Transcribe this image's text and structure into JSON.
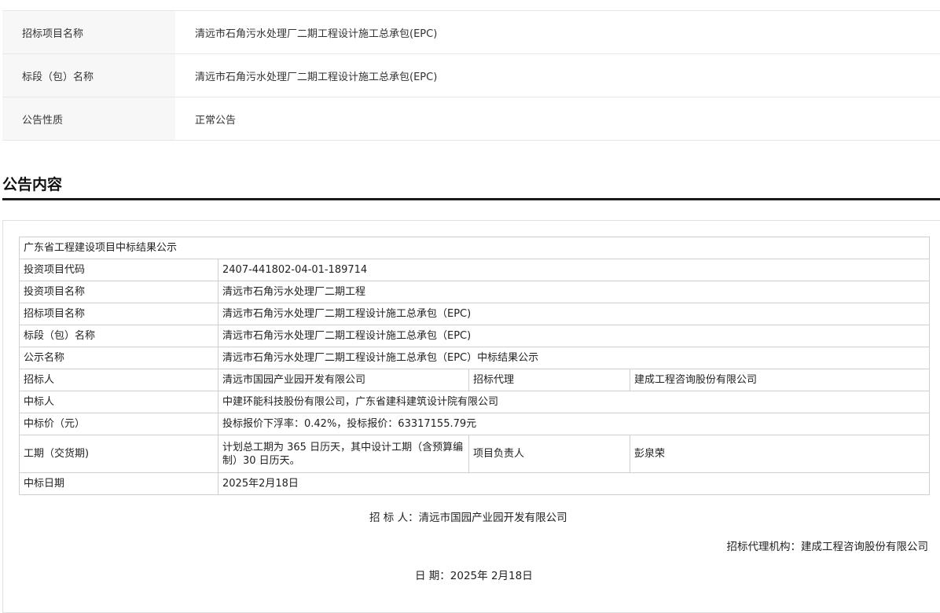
{
  "summary": {
    "rows": [
      {
        "label": "招标项目名称",
        "value": "清远市石角污水处理厂二期工程设计施工总承包(EPC)"
      },
      {
        "label": "标段（包）名称",
        "value": "清远市石角污水处理厂二期工程设计施工总承包(EPC)"
      },
      {
        "label": "公告性质",
        "value": "正常公告"
      }
    ]
  },
  "section": {
    "title": "公告内容"
  },
  "notice": {
    "heading": "广东省工程建设项目中标结果公示",
    "rows": {
      "investment_code": {
        "label": "投资项目代码",
        "value": "2407-441802-04-01-189714"
      },
      "investment_name": {
        "label": "投资项目名称",
        "value": "清远市石角污水处理厂二期工程"
      },
      "tender_project": {
        "label": "招标项目名称",
        "value": "清远市石角污水处理厂二期工程设计施工总承包（EPC)"
      },
      "lot_name": {
        "label": "标段（包）名称",
        "value": "清远市石角污水处理厂二期工程设计施工总承包（EPC)"
      },
      "publicity_name": {
        "label": "公示名称",
        "value": "清远市石角污水处理厂二期工程设计施工总承包（EPC）中标结果公示"
      },
      "tenderer": {
        "label": "招标人",
        "value": "清远市国园产业园开发有限公司",
        "label2": "招标代理",
        "value2": "建成工程咨询股份有限公司"
      },
      "winner": {
        "label": "中标人",
        "value": "中建环能科技股份有限公司，广东省建科建筑设计院有限公司"
      },
      "price": {
        "label": "中标价（元）",
        "value": "投标报价下浮率：0.42%，投标报价：63317155.79元"
      },
      "duration": {
        "label": "工期（交货期)",
        "value": "计划总工期为 365 日历天，其中设计工期（含预算编制）30 日历天。",
        "label2": "项目负责人",
        "value2": "彭泉荣"
      },
      "award_date": {
        "label": "中标日期",
        "value": "2025年2月18日"
      }
    }
  },
  "footer": {
    "tenderer_line": "招 标 人：清远市国园产业园开发有限公司",
    "agent_line": "招标代理机构：建成工程咨询股份有限公司",
    "date_line": "日 期：2025年 2月18日"
  }
}
